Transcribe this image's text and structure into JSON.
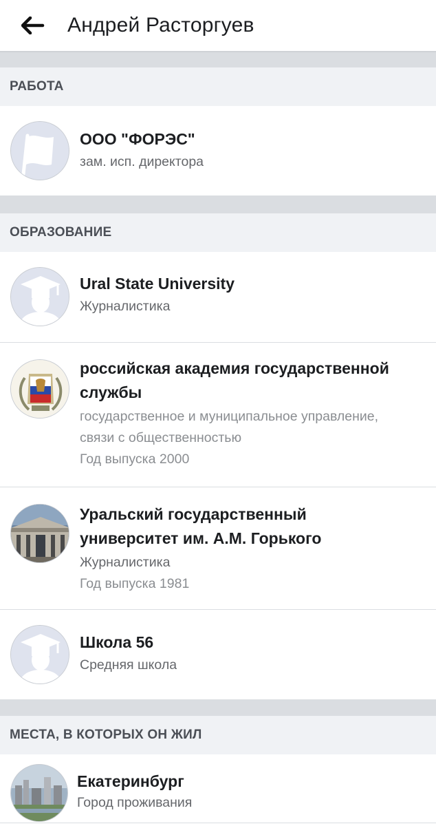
{
  "header": {
    "title": "Андрей Расторгуев",
    "back_icon": "arrow-left-icon"
  },
  "sections": {
    "work": {
      "heading": "РАБОТА",
      "items": [
        {
          "title": "ООО \"ФОРЭС\"",
          "subtitle": "зам. исп. директора",
          "icon": "flag-icon"
        }
      ]
    },
    "education": {
      "heading": "ОБРАЗОВАНИЕ",
      "items": [
        {
          "title": "Ural State University",
          "subtitle": "Журналистика",
          "icon": "graduation-cap-icon"
        },
        {
          "title_line1": "российская академия государственной",
          "title_line2": "службы",
          "subtitle_line1": "государственное и муниципальное управление,",
          "subtitle_line2": "связи с общественностью",
          "year": "Год выпуска 2000",
          "icon": "academy-emblem"
        },
        {
          "title_line1": "Уральский государственный",
          "title_line2": "университет им. А.М. Горького",
          "subtitle": "Журналистика",
          "year": "Год выпуска 1981",
          "icon": "university-building-photo"
        },
        {
          "title": "Школа 56",
          "subtitle": "Средняя школа",
          "icon": "graduation-cap-icon"
        }
      ]
    },
    "places": {
      "heading": "МЕСТА, В КОТОРЫХ ОН ЖИЛ",
      "items": [
        {
          "title": "Екатеринбург",
          "subtitle": "Город проживания",
          "icon": "city-photo"
        }
      ]
    }
  },
  "colors": {
    "placeholder_bg": "#dfe3ee",
    "placeholder_fg": "#ffffff",
    "section_bg": "#f0f2f5",
    "gap_bg": "#dadde1"
  }
}
